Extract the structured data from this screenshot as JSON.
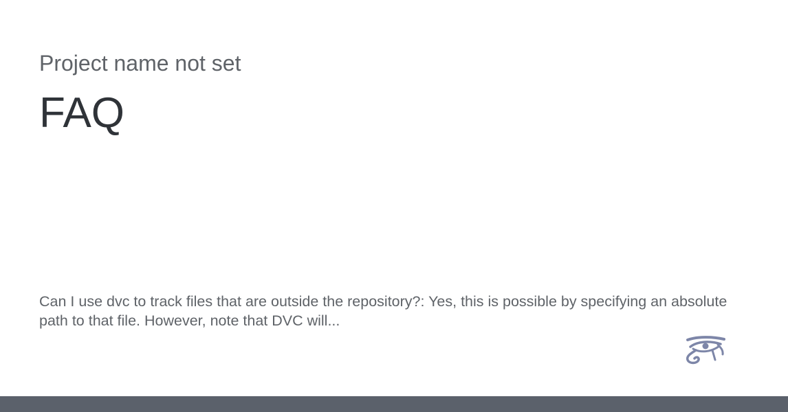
{
  "header": {
    "project_name": "Project name not set",
    "title": "FAQ"
  },
  "main": {
    "description": "Can I use dvc to track files that are outside the repository?: Yes, this is possible by specifying an absolute path to that file. However, note that DVC will..."
  },
  "logo": {
    "icon": "eye-of-horus-icon",
    "color": "#7d86a8"
  },
  "footer": {
    "color": "#5b616b"
  }
}
